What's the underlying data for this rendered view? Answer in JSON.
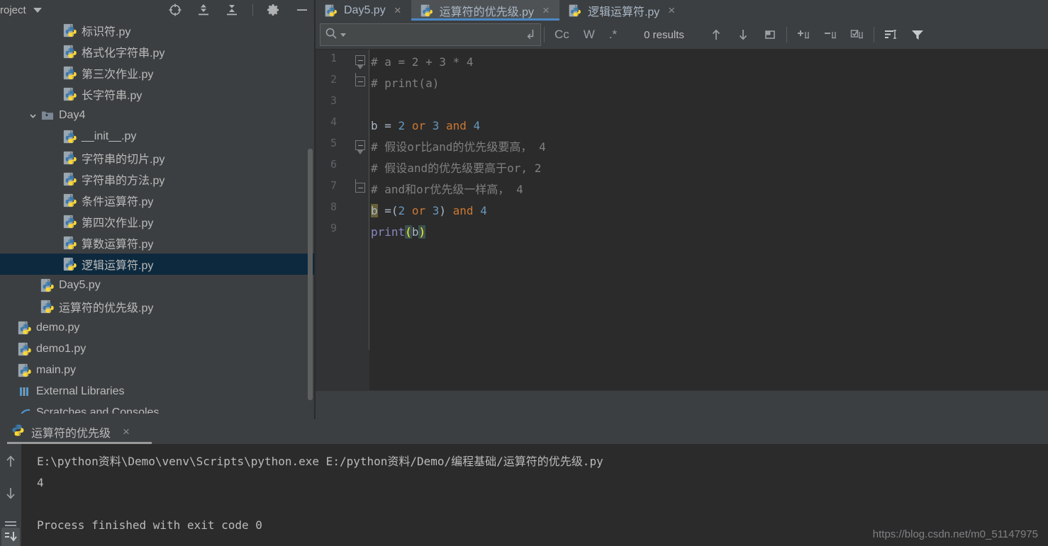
{
  "project_panel": {
    "title": "roject",
    "caret_icon": "chevron-down-icon",
    "header_icons": [
      {
        "name": "locate-target-icon",
        "label": "Select Opened File"
      },
      {
        "name": "expand-all-icon",
        "label": "Expand All"
      },
      {
        "name": "collapse-all-icon",
        "label": "Collapse All"
      },
      {
        "name": "gear-icon",
        "label": "Settings"
      },
      {
        "name": "minimize-icon",
        "label": "Hide"
      }
    ],
    "tree": [
      {
        "label": "标识符.py",
        "icon": "python-file-icon",
        "indent": 2,
        "arrow": "",
        "selected": false
      },
      {
        "label": "格式化字符串.py",
        "icon": "python-file-icon",
        "indent": 2,
        "arrow": "",
        "selected": false
      },
      {
        "label": "第三次作业.py",
        "icon": "python-file-icon",
        "indent": 2,
        "arrow": "",
        "selected": false
      },
      {
        "label": "长字符串.py",
        "icon": "python-file-icon",
        "indent": 2,
        "arrow": "",
        "selected": false
      },
      {
        "label": "Day4",
        "icon": "folder-icon",
        "indent": 1,
        "arrow": "chevron-down-icon",
        "selected": false
      },
      {
        "label": "__init__.py",
        "icon": "python-file-icon",
        "indent": 2,
        "arrow": "",
        "selected": false
      },
      {
        "label": "字符串的切片.py",
        "icon": "python-file-icon",
        "indent": 2,
        "arrow": "",
        "selected": false
      },
      {
        "label": "字符串的方法.py",
        "icon": "python-file-icon",
        "indent": 2,
        "arrow": "",
        "selected": false
      },
      {
        "label": "条件运算符.py",
        "icon": "python-file-icon",
        "indent": 2,
        "arrow": "",
        "selected": false
      },
      {
        "label": "第四次作业.py",
        "icon": "python-file-icon",
        "indent": 2,
        "arrow": "",
        "selected": false
      },
      {
        "label": "算数运算符.py",
        "icon": "python-file-icon",
        "indent": 2,
        "arrow": "",
        "selected": false
      },
      {
        "label": "逻辑运算符.py",
        "icon": "python-file-icon",
        "indent": 2,
        "arrow": "",
        "selected": true
      },
      {
        "label": "Day5.py",
        "icon": "python-file-icon",
        "indent": 1,
        "arrow": "",
        "selected": false
      },
      {
        "label": "运算符的优先级.py",
        "icon": "python-file-icon",
        "indent": 1,
        "arrow": "",
        "selected": false
      },
      {
        "label": "demo.py",
        "icon": "python-file-icon",
        "indent": 0,
        "arrow": "",
        "selected": false
      },
      {
        "label": "demo1.py",
        "icon": "python-file-icon",
        "indent": 0,
        "arrow": "",
        "selected": false
      },
      {
        "label": "main.py",
        "icon": "python-file-icon",
        "indent": 0,
        "arrow": "",
        "selected": false
      },
      {
        "label": "External Libraries",
        "icon": "library-icon",
        "indent": 0,
        "arrow": "",
        "selected": false
      },
      {
        "label": "Scratches and Consoles",
        "icon": "scratches-icon",
        "indent": 0,
        "arrow": "",
        "selected": false
      }
    ]
  },
  "editor": {
    "tabs": [
      {
        "label": "Day5.py",
        "icon": "python-file-icon",
        "active": false,
        "close": "×"
      },
      {
        "label": "运算符的优先级.py",
        "icon": "python-file-icon",
        "active": true,
        "close": "×"
      },
      {
        "label": "逻辑运算符.py",
        "icon": "python-file-icon",
        "active": false,
        "close": "×"
      }
    ],
    "find_bar": {
      "search_value": "",
      "search_placeholder": "",
      "search_icon": "search-icon",
      "dropdown_icon": "chevron-down-icon",
      "multiline_icon": "multiline-toggle-icon",
      "match_case_label": "Cc",
      "words_label": "W",
      "regex_label": ".*",
      "results_label": "0 results",
      "icons": [
        {
          "name": "find-previous-icon",
          "glyph": "↑"
        },
        {
          "name": "find-next-icon",
          "glyph": "↓"
        },
        {
          "name": "select-all-occurrences-icon",
          "glyph": "□"
        },
        {
          "name": "add-selection-icon",
          "glyph": "+"
        },
        {
          "name": "remove-selection-icon",
          "glyph": "−"
        },
        {
          "name": "toggle-selection-icon",
          "glyph": "☑"
        },
        {
          "name": "find-in-selection-icon",
          "glyph": "≡"
        },
        {
          "name": "filter-icon",
          "glyph": "▼"
        }
      ]
    },
    "line_numbers": [
      "1",
      "2",
      "3",
      "4",
      "5",
      "6",
      "7",
      "8",
      "9"
    ],
    "code_lines": [
      {
        "n": 1,
        "fold": "arrowdown",
        "tokens": [
          {
            "t": "# a = 2 + 3 * 4",
            "c": "c-comment"
          }
        ]
      },
      {
        "n": 2,
        "fold": "cornerup",
        "tokens": [
          {
            "t": "# print(a)",
            "c": "c-comment"
          }
        ]
      },
      {
        "n": 3,
        "fold": "",
        "tokens": []
      },
      {
        "n": 4,
        "fold": "",
        "tokens": [
          {
            "t": "b",
            "c": "c-var"
          },
          {
            "t": " = ",
            "c": "c-var"
          },
          {
            "t": "2",
            "c": "c-num"
          },
          {
            "t": " ",
            "c": "c-var"
          },
          {
            "t": "or",
            "c": "c-kw"
          },
          {
            "t": " ",
            "c": "c-var"
          },
          {
            "t": "3",
            "c": "c-num"
          },
          {
            "t": " ",
            "c": "c-var"
          },
          {
            "t": "and",
            "c": "c-kw"
          },
          {
            "t": " ",
            "c": "c-var"
          },
          {
            "t": "4",
            "c": "c-num"
          }
        ]
      },
      {
        "n": 5,
        "fold": "arrowdown",
        "tokens": [
          {
            "t": "# 假设or比and的优先级要高， 4",
            "c": "c-comment"
          }
        ]
      },
      {
        "n": 6,
        "fold": "",
        "tokens": [
          {
            "t": "# 假设and的优先级要高于or, 2",
            "c": "c-comment"
          }
        ]
      },
      {
        "n": 7,
        "fold": "cornerup",
        "tokens": [
          {
            "t": "# and和or优先级一样高， 4",
            "c": "c-comment"
          }
        ]
      },
      {
        "n": 8,
        "fold": "",
        "tokens": [
          {
            "t": "b",
            "c": "c-hl"
          },
          {
            "t": " =",
            "c": "c-var"
          },
          {
            "t": "(",
            "c": "c-var"
          },
          {
            "t": "2",
            "c": "c-num"
          },
          {
            "t": " ",
            "c": "c-var"
          },
          {
            "t": "or",
            "c": "c-kw"
          },
          {
            "t": " ",
            "c": "c-var"
          },
          {
            "t": "3",
            "c": "c-num"
          },
          {
            "t": ")",
            "c": "c-var"
          },
          {
            "t": " ",
            "c": "c-var"
          },
          {
            "t": "and",
            "c": "c-kw"
          },
          {
            "t": " ",
            "c": "c-var"
          },
          {
            "t": "4",
            "c": "c-num"
          }
        ]
      },
      {
        "n": 9,
        "fold": "",
        "tokens": [
          {
            "t": "print",
            "c": "c-fn"
          },
          {
            "t": "(",
            "c": "c-brk"
          },
          {
            "t": "b",
            "c": "c-var"
          },
          {
            "t": ")",
            "c": "c-brk"
          }
        ]
      }
    ]
  },
  "console": {
    "tab_label": "运算符的优先级",
    "tab_icon": "python-file-icon",
    "tab_close": "×",
    "rail_icons": [
      {
        "name": "scroll-up-icon",
        "glyph": "↑"
      },
      {
        "name": "scroll-down-icon",
        "glyph": "↓"
      },
      {
        "name": "soft-wrap-icon",
        "glyph": "↵"
      },
      {
        "name": "scroll-to-end-icon",
        "glyph": "⇩"
      }
    ],
    "output": [
      "E:\\python资料\\Demo\\venv\\Scripts\\python.exe E:/python资料/Demo/编程基础/运算符的优先级.py",
      "4",
      "",
      "Process finished with exit code 0"
    ]
  },
  "watermark": "https://blog.csdn.net/m0_51147975",
  "colors": {
    "panel_bg": "#3C3F41",
    "editor_bg": "#2B2B2B",
    "gutter_bg": "#313335",
    "selection_blue": "#0D293E",
    "tab_active_bg": "#4E5254",
    "tab_underline": "#4A88C7",
    "text": "#BBBBBB",
    "code_text": "#A9B7C6",
    "comment": "#808080",
    "keyword": "#CC7832",
    "number": "#6897BB",
    "function": "#8888C6",
    "highlight_ident": "#676038",
    "bracket_match": "#3B514D"
  }
}
